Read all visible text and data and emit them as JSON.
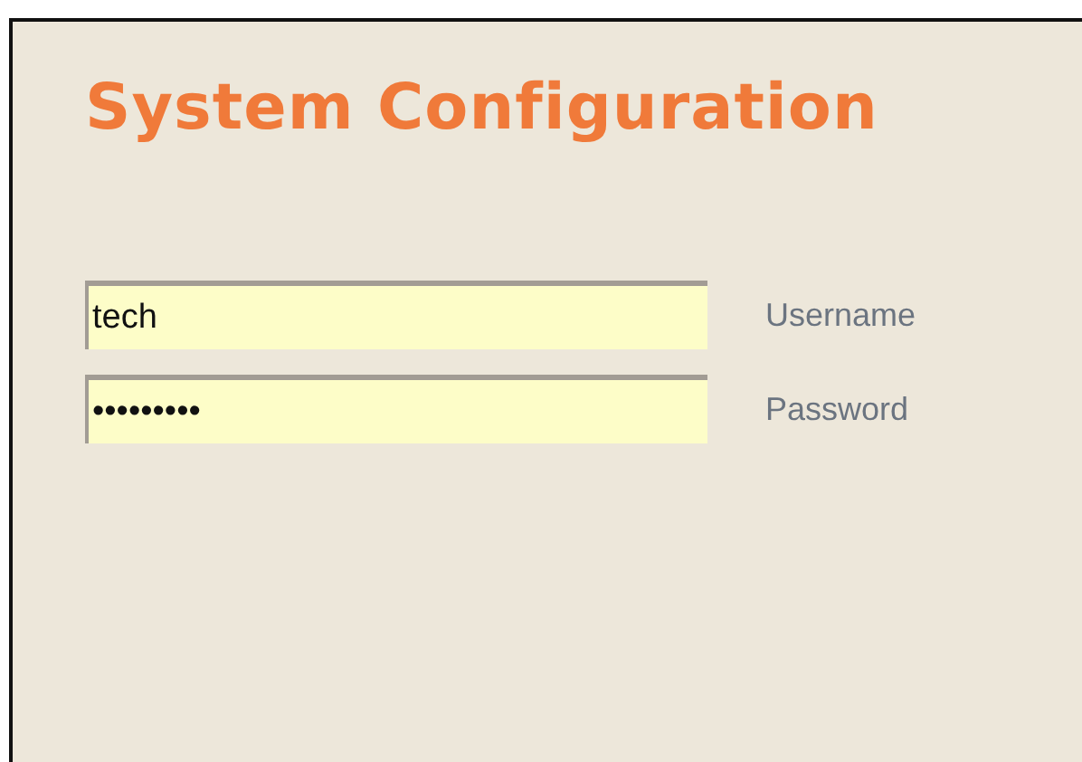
{
  "title": "System Configuration",
  "fields": [
    {
      "label": "Username",
      "value": "tech"
    },
    {
      "label": "Password",
      "value": "•••••••••"
    }
  ]
}
